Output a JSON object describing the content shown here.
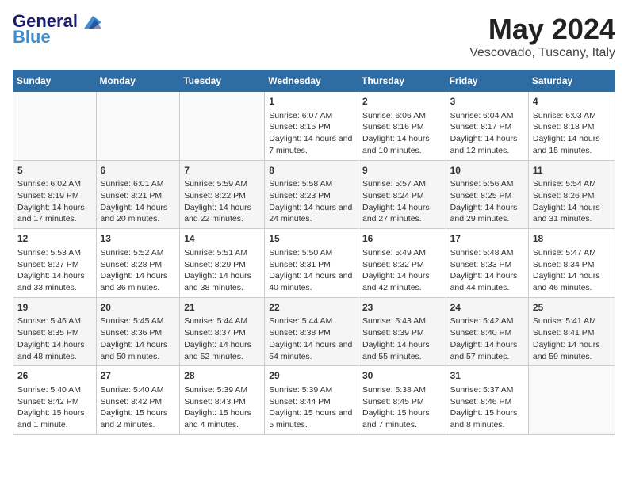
{
  "logo": {
    "general": "General",
    "blue": "Blue"
  },
  "title": "May 2024",
  "subtitle": "Vescovado, Tuscany, Italy",
  "days_of_week": [
    "Sunday",
    "Monday",
    "Tuesday",
    "Wednesday",
    "Thursday",
    "Friday",
    "Saturday"
  ],
  "weeks": [
    [
      {
        "day": "",
        "empty": true
      },
      {
        "day": "",
        "empty": true
      },
      {
        "day": "",
        "empty": true
      },
      {
        "day": "1",
        "sunrise": "Sunrise: 6:07 AM",
        "sunset": "Sunset: 8:15 PM",
        "daylight": "Daylight: 14 hours and 7 minutes."
      },
      {
        "day": "2",
        "sunrise": "Sunrise: 6:06 AM",
        "sunset": "Sunset: 8:16 PM",
        "daylight": "Daylight: 14 hours and 10 minutes."
      },
      {
        "day": "3",
        "sunrise": "Sunrise: 6:04 AM",
        "sunset": "Sunset: 8:17 PM",
        "daylight": "Daylight: 14 hours and 12 minutes."
      },
      {
        "day": "4",
        "sunrise": "Sunrise: 6:03 AM",
        "sunset": "Sunset: 8:18 PM",
        "daylight": "Daylight: 14 hours and 15 minutes."
      }
    ],
    [
      {
        "day": "5",
        "sunrise": "Sunrise: 6:02 AM",
        "sunset": "Sunset: 8:19 PM",
        "daylight": "Daylight: 14 hours and 17 minutes."
      },
      {
        "day": "6",
        "sunrise": "Sunrise: 6:01 AM",
        "sunset": "Sunset: 8:21 PM",
        "daylight": "Daylight: 14 hours and 20 minutes."
      },
      {
        "day": "7",
        "sunrise": "Sunrise: 5:59 AM",
        "sunset": "Sunset: 8:22 PM",
        "daylight": "Daylight: 14 hours and 22 minutes."
      },
      {
        "day": "8",
        "sunrise": "Sunrise: 5:58 AM",
        "sunset": "Sunset: 8:23 PM",
        "daylight": "Daylight: 14 hours and 24 minutes."
      },
      {
        "day": "9",
        "sunrise": "Sunrise: 5:57 AM",
        "sunset": "Sunset: 8:24 PM",
        "daylight": "Daylight: 14 hours and 27 minutes."
      },
      {
        "day": "10",
        "sunrise": "Sunrise: 5:56 AM",
        "sunset": "Sunset: 8:25 PM",
        "daylight": "Daylight: 14 hours and 29 minutes."
      },
      {
        "day": "11",
        "sunrise": "Sunrise: 5:54 AM",
        "sunset": "Sunset: 8:26 PM",
        "daylight": "Daylight: 14 hours and 31 minutes."
      }
    ],
    [
      {
        "day": "12",
        "sunrise": "Sunrise: 5:53 AM",
        "sunset": "Sunset: 8:27 PM",
        "daylight": "Daylight: 14 hours and 33 minutes."
      },
      {
        "day": "13",
        "sunrise": "Sunrise: 5:52 AM",
        "sunset": "Sunset: 8:28 PM",
        "daylight": "Daylight: 14 hours and 36 minutes."
      },
      {
        "day": "14",
        "sunrise": "Sunrise: 5:51 AM",
        "sunset": "Sunset: 8:29 PM",
        "daylight": "Daylight: 14 hours and 38 minutes."
      },
      {
        "day": "15",
        "sunrise": "Sunrise: 5:50 AM",
        "sunset": "Sunset: 8:31 PM",
        "daylight": "Daylight: 14 hours and 40 minutes."
      },
      {
        "day": "16",
        "sunrise": "Sunrise: 5:49 AM",
        "sunset": "Sunset: 8:32 PM",
        "daylight": "Daylight: 14 hours and 42 minutes."
      },
      {
        "day": "17",
        "sunrise": "Sunrise: 5:48 AM",
        "sunset": "Sunset: 8:33 PM",
        "daylight": "Daylight: 14 hours and 44 minutes."
      },
      {
        "day": "18",
        "sunrise": "Sunrise: 5:47 AM",
        "sunset": "Sunset: 8:34 PM",
        "daylight": "Daylight: 14 hours and 46 minutes."
      }
    ],
    [
      {
        "day": "19",
        "sunrise": "Sunrise: 5:46 AM",
        "sunset": "Sunset: 8:35 PM",
        "daylight": "Daylight: 14 hours and 48 minutes."
      },
      {
        "day": "20",
        "sunrise": "Sunrise: 5:45 AM",
        "sunset": "Sunset: 8:36 PM",
        "daylight": "Daylight: 14 hours and 50 minutes."
      },
      {
        "day": "21",
        "sunrise": "Sunrise: 5:44 AM",
        "sunset": "Sunset: 8:37 PM",
        "daylight": "Daylight: 14 hours and 52 minutes."
      },
      {
        "day": "22",
        "sunrise": "Sunrise: 5:44 AM",
        "sunset": "Sunset: 8:38 PM",
        "daylight": "Daylight: 14 hours and 54 minutes."
      },
      {
        "day": "23",
        "sunrise": "Sunrise: 5:43 AM",
        "sunset": "Sunset: 8:39 PM",
        "daylight": "Daylight: 14 hours and 55 minutes."
      },
      {
        "day": "24",
        "sunrise": "Sunrise: 5:42 AM",
        "sunset": "Sunset: 8:40 PM",
        "daylight": "Daylight: 14 hours and 57 minutes."
      },
      {
        "day": "25",
        "sunrise": "Sunrise: 5:41 AM",
        "sunset": "Sunset: 8:41 PM",
        "daylight": "Daylight: 14 hours and 59 minutes."
      }
    ],
    [
      {
        "day": "26",
        "sunrise": "Sunrise: 5:40 AM",
        "sunset": "Sunset: 8:42 PM",
        "daylight": "Daylight: 15 hours and 1 minute."
      },
      {
        "day": "27",
        "sunrise": "Sunrise: 5:40 AM",
        "sunset": "Sunset: 8:42 PM",
        "daylight": "Daylight: 15 hours and 2 minutes."
      },
      {
        "day": "28",
        "sunrise": "Sunrise: 5:39 AM",
        "sunset": "Sunset: 8:43 PM",
        "daylight": "Daylight: 15 hours and 4 minutes."
      },
      {
        "day": "29",
        "sunrise": "Sunrise: 5:39 AM",
        "sunset": "Sunset: 8:44 PM",
        "daylight": "Daylight: 15 hours and 5 minutes."
      },
      {
        "day": "30",
        "sunrise": "Sunrise: 5:38 AM",
        "sunset": "Sunset: 8:45 PM",
        "daylight": "Daylight: 15 hours and 7 minutes."
      },
      {
        "day": "31",
        "sunrise": "Sunrise: 5:37 AM",
        "sunset": "Sunset: 8:46 PM",
        "daylight": "Daylight: 15 hours and 8 minutes."
      },
      {
        "day": "",
        "empty": true
      }
    ]
  ]
}
